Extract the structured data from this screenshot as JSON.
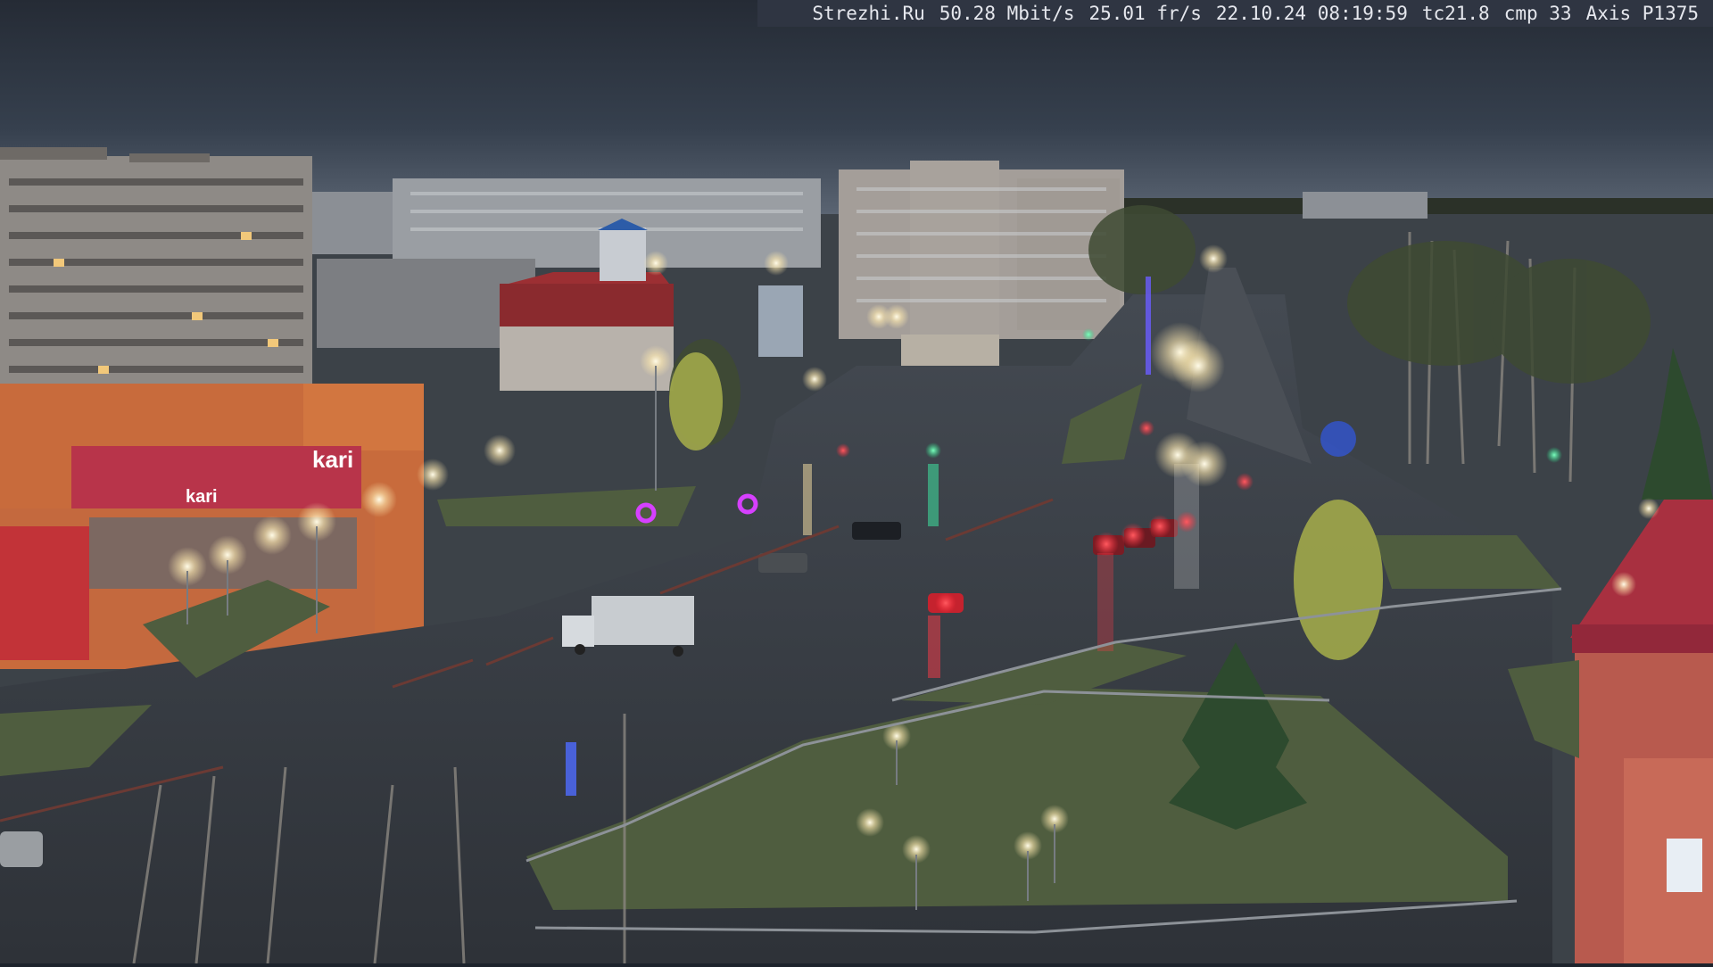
{
  "camera_overlay": {
    "site": "Strezhi.Ru",
    "bitrate": "50.28 Mbit/s",
    "framerate": "25.01 fr/s",
    "datetime": "22.10.24 08:19:59",
    "tc": "tc21.8",
    "cmp": "cmp 33",
    "model": "Axis P1375"
  },
  "signs": {
    "store_sign": "kari",
    "store_sign_2": "kari"
  },
  "colors": {
    "sky": "#2e3542",
    "overlay_bg": "#2f3542",
    "wet_road": "#3a3f47",
    "grass": "#4b5a3e",
    "taillight": "#ff2b3a",
    "streetlight": "#fff6d8",
    "signal_green": "#28e08a"
  }
}
